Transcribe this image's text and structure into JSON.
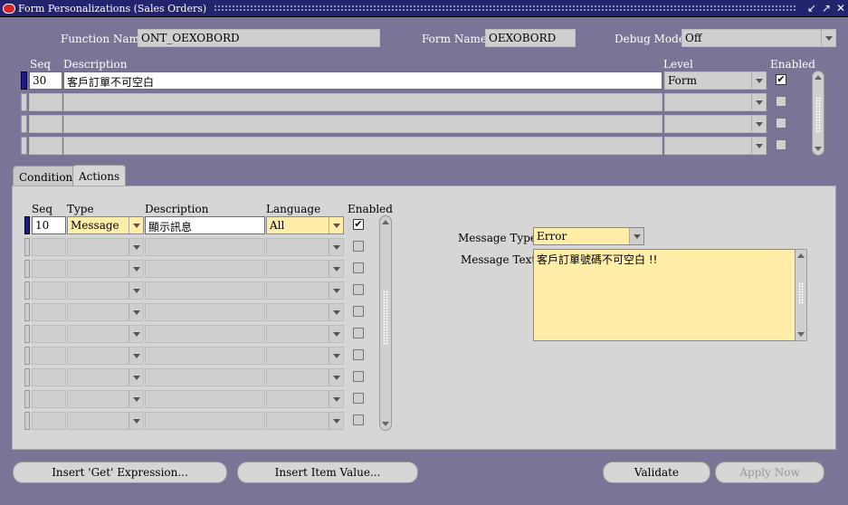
{
  "window": {
    "title": "Form Personalizations (Sales Orders)",
    "controls": [
      "minimize-icon",
      "maximize-icon",
      "close-icon"
    ]
  },
  "header": {
    "function_name_label": "Function Name",
    "function_name_value": "ONT_OEXOBORD",
    "form_name_label": "Form Name",
    "form_name_value": "OEXOBORD",
    "debug_mode_label": "Debug Mode",
    "debug_mode_value": "Off"
  },
  "rules": {
    "col_seq": "Seq",
    "col_description": "Description",
    "col_level": "Level",
    "col_enabled": "Enabled",
    "rows": [
      {
        "seq": "30",
        "description": "客戶訂單不可空白",
        "level": "Form",
        "enabled": true
      },
      {
        "seq": "",
        "description": "",
        "level": "",
        "enabled": false
      },
      {
        "seq": "",
        "description": "",
        "level": "",
        "enabled": false
      },
      {
        "seq": "",
        "description": "",
        "level": "",
        "enabled": false
      }
    ]
  },
  "tabs": [
    {
      "label": "Condition",
      "active": false
    },
    {
      "label": "Actions",
      "active": true
    }
  ],
  "actions": {
    "col_seq": "Seq",
    "col_type": "Type",
    "col_description": "Description",
    "col_language": "Language",
    "col_enabled": "Enabled",
    "rows": [
      {
        "seq": "10",
        "type": "Message",
        "description": "顯示訊息",
        "language": "All",
        "enabled": true
      },
      {
        "seq": "",
        "type": "",
        "description": "",
        "language": "",
        "enabled": false
      },
      {
        "seq": "",
        "type": "",
        "description": "",
        "language": "",
        "enabled": false
      },
      {
        "seq": "",
        "type": "",
        "description": "",
        "language": "",
        "enabled": false
      },
      {
        "seq": "",
        "type": "",
        "description": "",
        "language": "",
        "enabled": false
      },
      {
        "seq": "",
        "type": "",
        "description": "",
        "language": "",
        "enabled": false
      },
      {
        "seq": "",
        "type": "",
        "description": "",
        "language": "",
        "enabled": false
      },
      {
        "seq": "",
        "type": "",
        "description": "",
        "language": "",
        "enabled": false
      },
      {
        "seq": "",
        "type": "",
        "description": "",
        "language": "",
        "enabled": false
      },
      {
        "seq": "",
        "type": "",
        "description": "",
        "language": "",
        "enabled": false
      }
    ]
  },
  "message": {
    "type_label": "Message Type",
    "type_value": "Error",
    "text_label": "Message Text",
    "text_value": "客戶訂單號碼不可空白 !!"
  },
  "buttons": {
    "insert_get_expression": "Insert 'Get' Expression...",
    "insert_item_value": "Insert Item Value...",
    "validate": "Validate",
    "apply_now": "Apply Now"
  },
  "colors": {
    "background": "#7a7597",
    "titlebar": "#24246e",
    "required_field": "#ffeda8",
    "panel": "#d6d6d6"
  }
}
